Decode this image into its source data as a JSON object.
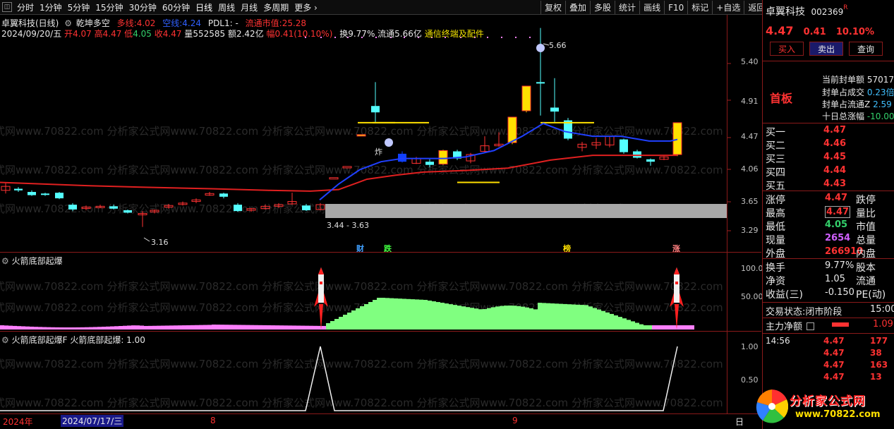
{
  "topbar": {
    "items": [
      "分时",
      "1分钟",
      "5分钟",
      "15分钟",
      "30分钟",
      "60分钟",
      "日线",
      "周线",
      "月线",
      "多周期",
      "更多"
    ],
    "more_arrow": "›",
    "square_label": "◫"
  },
  "toolbar": {
    "buttons": [
      "复权",
      "叠加",
      "多股",
      "统计",
      "画线",
      "F10",
      "标记",
      "+自选",
      "返回"
    ]
  },
  "main": {
    "title": "卓翼科技(日线)",
    "indicator_name": "乾坤多空",
    "dxx_label": "多线:",
    "dxx_value": "4.02",
    "kx_label": "空线:",
    "kx_value": "4.24",
    "pdl_label": "PDL1: -",
    "ltsz_label": "流通市值:",
    "ltsz_value": "25.28",
    "quote_date": "2024/09/20/五",
    "open_label": "开",
    "open": "4.07",
    "high_label": "高",
    "high": "4.47",
    "low_label": "低",
    "low": "4.05",
    "close_label": "收",
    "close": "4.47",
    "vol_label": "量",
    "vol": "552585",
    "amt_label": "额",
    "amt": "2.42亿",
    "amp_label": "幅",
    "amp": "0.41(10.10%)",
    "turnover_text": "换9.77% 流通5.66亿",
    "sector": "通信终端及配件",
    "hi_label": "5.66",
    "lo_label": "3.16",
    "box_label": "3.44 - 3.63",
    "zha_label": "炸",
    "axis": {
      "ticks": [
        "5.40",
        "4.91",
        "4.47",
        "4.06",
        "3.65",
        "3.29"
      ]
    },
    "event_tags": [
      "财",
      "跌",
      "榜",
      "涨"
    ]
  },
  "sub1": {
    "title": "火箭底部起爆",
    "axis": [
      "100.0",
      "50.00"
    ]
  },
  "sub2": {
    "title": "火箭底部起爆F",
    "value_text": "火箭底部起爆: 1.00",
    "axis": [
      "1.00",
      "0.50"
    ]
  },
  "bottom": {
    "labels": [
      "2024年",
      "2024/07/17/三",
      "8",
      "9",
      "日"
    ]
  },
  "watermark": "式网www.70822.com 分析家公式网www.70822.com 分析家公式网www.70822.com 分析家公式网www.70822.com 分析家公式网www.70822.com",
  "right": {
    "name": "卓翼科技",
    "code": "002369",
    "code_flag": "R",
    "price": "4.47",
    "change": "0.41",
    "pct": "10.10%",
    "buttons": [
      "买入",
      "卖出",
      "查询"
    ],
    "board": "首板",
    "board_rows": [
      {
        "label": "当前封单额",
        "value": "57017"
      },
      {
        "label": "封单占成交",
        "value": "0.23倍"
      },
      {
        "label": "封单占流通Z",
        "value": "2.59"
      },
      {
        "label": "十日总涨幅",
        "value": "-10.00"
      }
    ],
    "bids": [
      {
        "label": "买一",
        "price": "4.47",
        "vol": ""
      },
      {
        "label": "买二",
        "price": "4.46",
        "vol": ""
      },
      {
        "label": "买三",
        "price": "4.45",
        "vol": ""
      },
      {
        "label": "买四",
        "price": "4.44",
        "vol": ""
      },
      {
        "label": "买五",
        "price": "4.43",
        "vol": ""
      }
    ],
    "stats": [
      {
        "l1": "涨停",
        "v1": "4.47",
        "l2": "跌停"
      },
      {
        "l1": "最高",
        "v1": "4.47",
        "l2": "量比"
      },
      {
        "l1": "最低",
        "v1": "4.05",
        "l2": "市值"
      },
      {
        "l1": "现量",
        "v1": "2654",
        "l2": "总量"
      },
      {
        "l1": "外盘",
        "v1": "266910",
        "l2": "内盘"
      }
    ],
    "stats2": [
      {
        "l1": "换手",
        "v1": "9.77%",
        "l2": "股本"
      },
      {
        "l1": "净资",
        "v1": "1.05",
        "l2": "流通"
      },
      {
        "l1": "收益(三)",
        "v1": "-0.150",
        "l2": "PE(动)"
      }
    ],
    "status_label": "交易状态:",
    "status_value": "闭市阶段",
    "status_time": "15:00",
    "flow_label": "主力净额",
    "flow_value": "1.09",
    "ticks": [
      {
        "time": "14:56",
        "price": "4.47",
        "vol": "177"
      },
      {
        "time": "",
        "price": "4.47",
        "vol": "38"
      },
      {
        "time": "",
        "price": "4.47",
        "vol": "163"
      },
      {
        "time": "",
        "price": "4.47",
        "vol": "13"
      }
    ],
    "logo_text": "分析家公式网",
    "logo_url": "www.70822.com"
  },
  "colors": {
    "up": "#ff3232",
    "down": "#54ffff",
    "bull": "#ffe000",
    "ma_red": "#e02020",
    "ma_blue": "#2040ff",
    "green": "#80ff80",
    "pink": "#ff80ff"
  }
}
